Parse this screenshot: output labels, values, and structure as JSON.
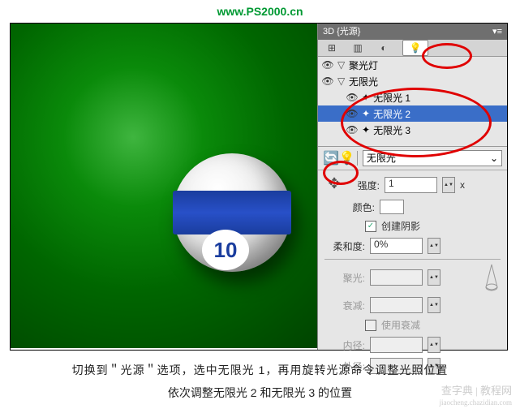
{
  "url": "www.PS2000.cn",
  "panel": {
    "title": "3D {光源}",
    "tree": {
      "spot": "聚光灯",
      "infinite": "无限光",
      "items": [
        "无限光 1",
        "无限光 2",
        "无限光 3"
      ]
    },
    "light_selector": "无限光",
    "intensity": {
      "label": "强度:",
      "value": "1",
      "unit": "x"
    },
    "color": {
      "label": "颜色:"
    },
    "shadow": {
      "label": "创建阴影"
    },
    "softness": {
      "label": "柔和度:",
      "value": "0%"
    },
    "spotlight": {
      "label": "聚光:"
    },
    "falloff": {
      "label": "衰减:"
    },
    "useAtten": {
      "label": "使用衰减"
    },
    "inner": {
      "label": "内径:"
    },
    "outer": {
      "label": "外径:"
    }
  },
  "ball_number": "10",
  "caption1": "切换到＂光源＂选项，选中无限光 1，再用旋转光源命令调整光照位置",
  "caption2": "依次调整无限光 2 和无限光 3 的位置",
  "watermark1": "查字典 | 教程网",
  "watermark2": "jiaocheng.chazidian.com"
}
